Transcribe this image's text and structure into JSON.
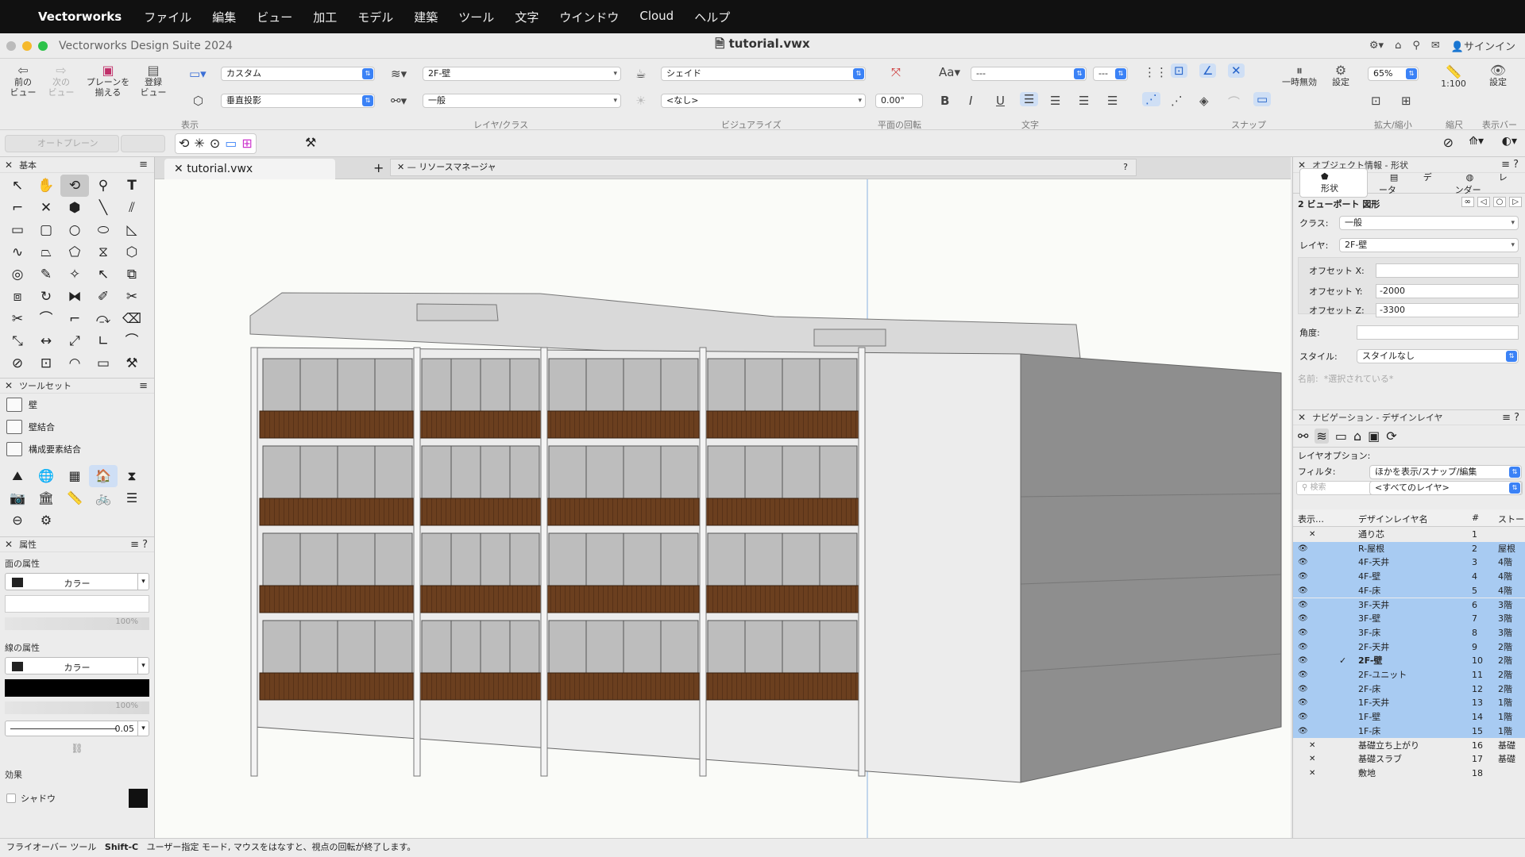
{
  "menubar": {
    "app": "Vectorworks",
    "items": [
      "ファイル",
      "編集",
      "ビュー",
      "加工",
      "モデル",
      "建築",
      "ツール",
      "文字",
      "ウインドウ",
      "Cloud",
      "ヘルプ"
    ]
  },
  "window": {
    "suite": "Vectorworks Design Suite 2024",
    "file": "tutorial.vwx",
    "signin": "サインイン"
  },
  "toolbar": {
    "prev_view": "前の\nビュー",
    "next_view": "次の\nビュー",
    "align_plane": "プレーンを\n揃える",
    "saved_view": "登録\nビュー",
    "plane": "カスタム",
    "projection": "垂直投影",
    "layer": "2F-壁",
    "class": "一般",
    "render": "シェイド",
    "lighting": "<なし>",
    "rotation": "0.00°",
    "font_dash1": "---",
    "font_dash2": "---",
    "pause": "一時無効",
    "settings": "設定",
    "zoom": "65%",
    "scale": "1:100",
    "display_settings": "設定",
    "groups": {
      "display": "表示",
      "layer_class": "レイヤ/クラス",
      "visualize": "ビジュアライズ",
      "plane_rot": "平面の回転",
      "text": "文字",
      "snap": "スナップ",
      "zoom": "拡大/縮小",
      "scale": "縮尺",
      "display_bar": "表示バー"
    }
  },
  "secbar": {
    "autoplane": "オートプレーン"
  },
  "left": {
    "basic": "基本",
    "toolset": "ツールセット",
    "toolsets": [
      "壁",
      "壁結合",
      "構成要素結合"
    ],
    "attributes": "属性",
    "fill_attr": "面の属性",
    "fill_type": "カラー",
    "fill_opacity": "100%",
    "line_attr": "線の属性",
    "line_type": "カラー",
    "line_opacity": "100%",
    "line_weight": "0.05",
    "effects": "効果",
    "shadow": "シャドウ"
  },
  "center": {
    "tab": "tutorial.vwx",
    "resource_manager": "リソースマネージャ"
  },
  "objinfo": {
    "title": "オブジェクト情報 - 形状",
    "tabs": [
      "形状",
      "データ",
      "レンダー"
    ],
    "type": "2 ビューポート 図形",
    "class_label": "クラス:",
    "class_value": "一般",
    "layer_label": "レイヤ:",
    "layer_value": "2F-壁",
    "offx_label": "オフセット X:",
    "offx": "",
    "offy_label": "オフセット Y:",
    "offy": "-2000",
    "offz_label": "オフセット Z:",
    "offz": "-3300",
    "angle_label": "角度:",
    "style_label": "スタイル:",
    "style_value": "スタイルなし",
    "name_label": "名前:",
    "name_value": "*選択されている*"
  },
  "nav": {
    "title": "ナビゲーション - デザインレイヤ",
    "layer_opt_label": "レイヤオプション:",
    "layer_opt": "ほかを表示/スナップ/編集",
    "filter_label": "フィルタ:",
    "filter": "<すべてのレイヤ>",
    "search_placeholder": "検索",
    "col_visibility": "表示…",
    "col_name": "デザインレイヤ名",
    "col_num": "#",
    "col_story": "ストー",
    "layers": [
      {
        "name": "通り芯",
        "num": "1",
        "story": "",
        "vis": "x",
        "hl": false
      },
      {
        "name": "R-屋根",
        "num": "2",
        "story": "屋根",
        "vis": "eye",
        "hl": true
      },
      {
        "name": "4F-天井",
        "num": "3",
        "story": "4階",
        "vis": "eye",
        "hl": true
      },
      {
        "name": "4F-壁",
        "num": "4",
        "story": "4階",
        "vis": "eye",
        "hl": true
      },
      {
        "name": "4F-床",
        "num": "5",
        "story": "4階",
        "vis": "eye",
        "hl": true
      },
      {
        "name": "3F-天井",
        "num": "6",
        "story": "3階",
        "vis": "eye",
        "hl": true
      },
      {
        "name": "3F-壁",
        "num": "7",
        "story": "3階",
        "vis": "eye",
        "hl": true
      },
      {
        "name": "3F-床",
        "num": "8",
        "story": "3階",
        "vis": "eye",
        "hl": true
      },
      {
        "name": "2F-天井",
        "num": "9",
        "story": "2階",
        "vis": "eye",
        "hl": true
      },
      {
        "name": "2F-壁",
        "num": "10",
        "story": "2階",
        "vis": "eye",
        "hl": true,
        "active": true
      },
      {
        "name": "2F-ユニット",
        "num": "11",
        "story": "2階",
        "vis": "eye",
        "hl": true
      },
      {
        "name": "2F-床",
        "num": "12",
        "story": "2階",
        "vis": "eye",
        "hl": true
      },
      {
        "name": "1F-天井",
        "num": "13",
        "story": "1階",
        "vis": "eye",
        "hl": true
      },
      {
        "name": "1F-壁",
        "num": "14",
        "story": "1階",
        "vis": "eye",
        "hl": true
      },
      {
        "name": "1F-床",
        "num": "15",
        "story": "1階",
        "vis": "eye",
        "hl": true
      },
      {
        "name": "基礎立ち上がり",
        "num": "16",
        "story": "基礎",
        "vis": "x",
        "hl": false
      },
      {
        "name": "基礎スラブ",
        "num": "17",
        "story": "基礎",
        "vis": "x",
        "hl": false
      },
      {
        "name": "敷地",
        "num": "18",
        "story": "",
        "vis": "x",
        "hl": false
      }
    ]
  },
  "status": {
    "tool": "フライオーバー ツール",
    "shortcut": "Shift-C",
    "message": "ユーザー指定 モード, マウスをはなすと、視点の回転が終了します。"
  }
}
